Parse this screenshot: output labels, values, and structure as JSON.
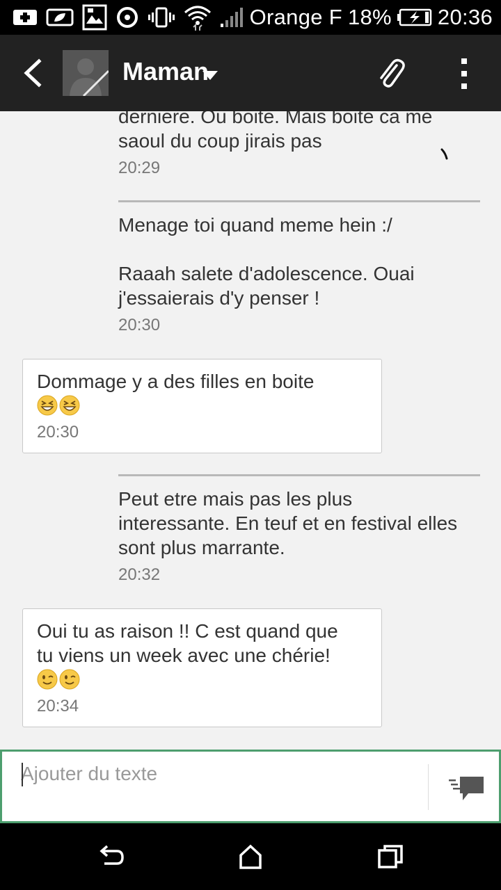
{
  "status_bar": {
    "carrier": "Orange F",
    "battery": "18%",
    "time": "20:36",
    "icons": [
      "notification-add-icon",
      "leaf-icon",
      "photo-icon",
      "sync-icon",
      "vibrate-icon",
      "wifi-icon",
      "signal-icon",
      "battery-charging-icon"
    ]
  },
  "header": {
    "contact_name": "Maman",
    "icons": [
      "back-arrow-icon",
      "avatar",
      "chevron-down-icon",
      "paperclip-icon",
      "more-vert-icon"
    ]
  },
  "messages": [
    {
      "direction": "sent",
      "text": "derniere. Ou boite. Mais boite ca me\nsaoul du coup jirais pas",
      "time": "20:29"
    },
    {
      "direction": "sent",
      "text": "Menage toi quand meme hein :/\n\nRaaah salete d'adolescence. Ouai\nj'essaierais d'y penser !",
      "time": "20:30"
    },
    {
      "direction": "received",
      "text": "Dommage y a des filles en boite",
      "emoji": [
        "grinning-squint-emoji",
        "grinning-squint-emoji"
      ],
      "time": "20:30"
    },
    {
      "direction": "sent",
      "text": "Peut etre mais pas les plus\ninteressante. En teuf et en festival elles\nsont plus marrante.",
      "time": "20:32"
    },
    {
      "direction": "received",
      "text": "Oui tu as raison !! C est quand que\ntu viens un week avec une chérie!",
      "emoji": [
        "winking-emoji",
        "winking-emoji"
      ],
      "time": "20:34"
    }
  ],
  "composer": {
    "placeholder": "Ajouter du texte",
    "value": ""
  },
  "colors": {
    "action_bar": "#222222",
    "background": "#f2f2f2",
    "composer_border": "#4d9e6e",
    "divider": "#b8b8b8"
  }
}
